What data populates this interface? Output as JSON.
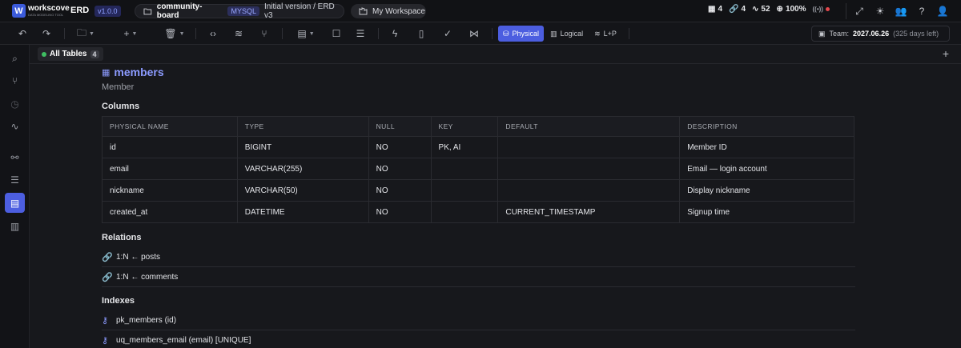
{
  "app": {
    "logo_letter": "W",
    "brand": "workscove",
    "tagline": "DATA MODELING TOOL",
    "product": "ERD",
    "version": "v1.0.0"
  },
  "project": {
    "name": "community-board",
    "db": "MYSQL",
    "version_label": "Initial version / ERD v3"
  },
  "workspace": {
    "label": "My Workspace"
  },
  "stats": {
    "tables": "4",
    "relations": "4",
    "activity": "52",
    "zoom": "100%"
  },
  "toolbar": {
    "modes": [
      "Physical",
      "Logical",
      "L+P"
    ],
    "active_mode": "Physical"
  },
  "team": {
    "label": "Team:",
    "date": "2027.06.26",
    "remaining": "(325 days left)"
  },
  "tabs": {
    "all_tables": "All Tables",
    "count": "4"
  },
  "entity": {
    "name": "members",
    "logical_name": "Member"
  },
  "sections": {
    "columns": "Columns",
    "relations": "Relations",
    "indexes": "Indexes"
  },
  "columns_table": {
    "headers": [
      "PHYSICAL NAME",
      "TYPE",
      "NULL",
      "KEY",
      "DEFAULT",
      "DESCRIPTION"
    ],
    "rows": [
      [
        "id",
        "BIGINT",
        "NO",
        "PK, AI",
        "",
        "Member ID"
      ],
      [
        "email",
        "VARCHAR(255)",
        "NO",
        "",
        "",
        "Email — login account"
      ],
      [
        "nickname",
        "VARCHAR(50)",
        "NO",
        "",
        "",
        "Display nickname"
      ],
      [
        "created_at",
        "DATETIME",
        "NO",
        "",
        "CURRENT_TIMESTAMP",
        "Signup time"
      ]
    ]
  },
  "relations": [
    "1:N ← posts",
    "1:N ← comments"
  ],
  "indexes": [
    "pk_members (id)",
    "uq_members_email (email) [UNIQUE]"
  ]
}
